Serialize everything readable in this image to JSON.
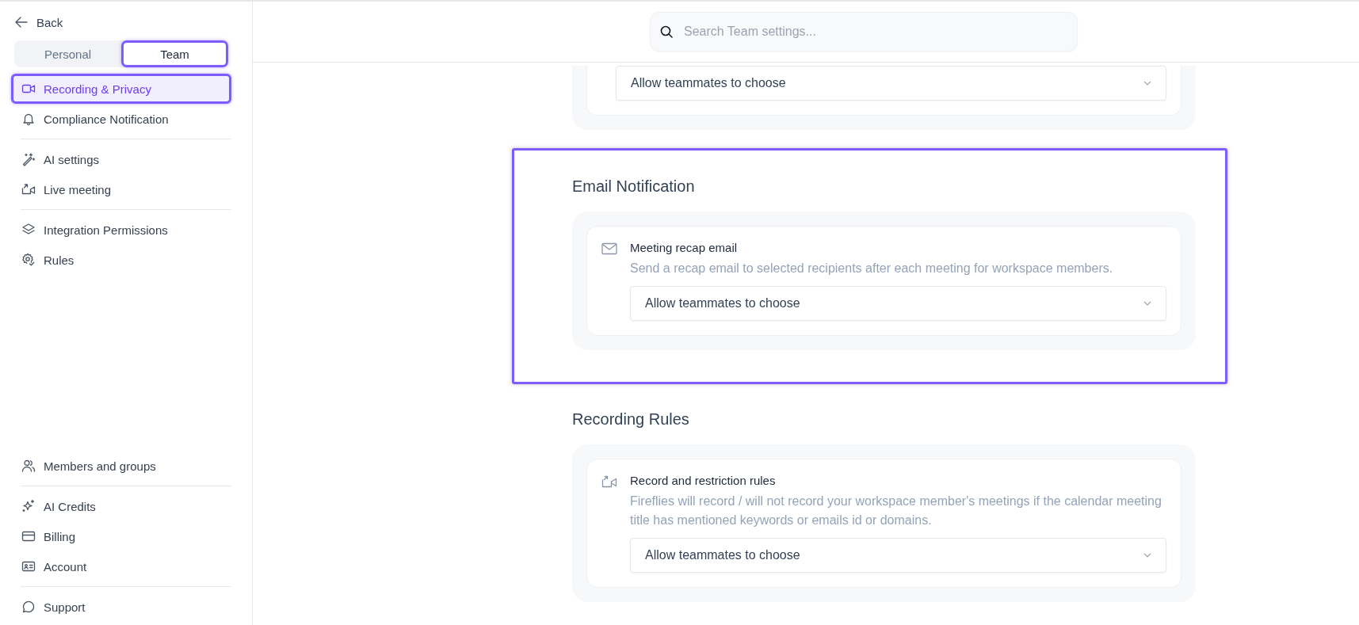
{
  "sidebar": {
    "back": "Back",
    "tabs": [
      {
        "label": "Personal",
        "selected": false,
        "highlighted": false
      },
      {
        "label": "Team",
        "selected": true,
        "highlighted": true
      }
    ],
    "top_groups": [
      [
        {
          "label": "Recording & Privacy",
          "selected": true,
          "highlighted": true
        },
        {
          "label": "Compliance Notification",
          "selected": false,
          "highlighted": false
        }
      ],
      [
        {
          "label": "AI settings",
          "selected": false,
          "highlighted": false
        },
        {
          "label": "Live meeting",
          "selected": false,
          "highlighted": false
        }
      ],
      [
        {
          "label": "Integration Permissions",
          "selected": false,
          "highlighted": false
        },
        {
          "label": "Rules",
          "selected": false,
          "highlighted": false
        }
      ]
    ],
    "bottom_groups": [
      [
        {
          "label": "Members and groups",
          "selected": false,
          "highlighted": false
        }
      ],
      [
        {
          "label": "AI Credits",
          "selected": false,
          "highlighted": false
        },
        {
          "label": "Billing",
          "selected": false,
          "highlighted": false
        },
        {
          "label": "Account",
          "selected": false,
          "highlighted": false
        }
      ],
      [
        {
          "label": "Support",
          "selected": false,
          "highlighted": false
        }
      ]
    ]
  },
  "search": {
    "placeholder": "Search Team settings..."
  },
  "sections": [
    {
      "highlighted": false,
      "settings": [
        {
          "dropdown": "Allow teammates to choose"
        }
      ]
    },
    {
      "heading": "Email Notification",
      "highlighted": true,
      "settings": [
        {
          "title": "Meeting recap email",
          "description": "Send a recap email to selected recipients after each meeting for workspace members.",
          "dropdown": "Allow teammates to choose"
        }
      ]
    },
    {
      "heading": "Recording Rules",
      "highlighted": false,
      "settings": [
        {
          "title": "Record and restriction rules",
          "description": "Fireflies will record / will not record your workspace member's meetings if the calendar meeting title has mentioned keywords or emails id or domains.",
          "dropdown": "Allow teammates to choose"
        }
      ]
    }
  ]
}
